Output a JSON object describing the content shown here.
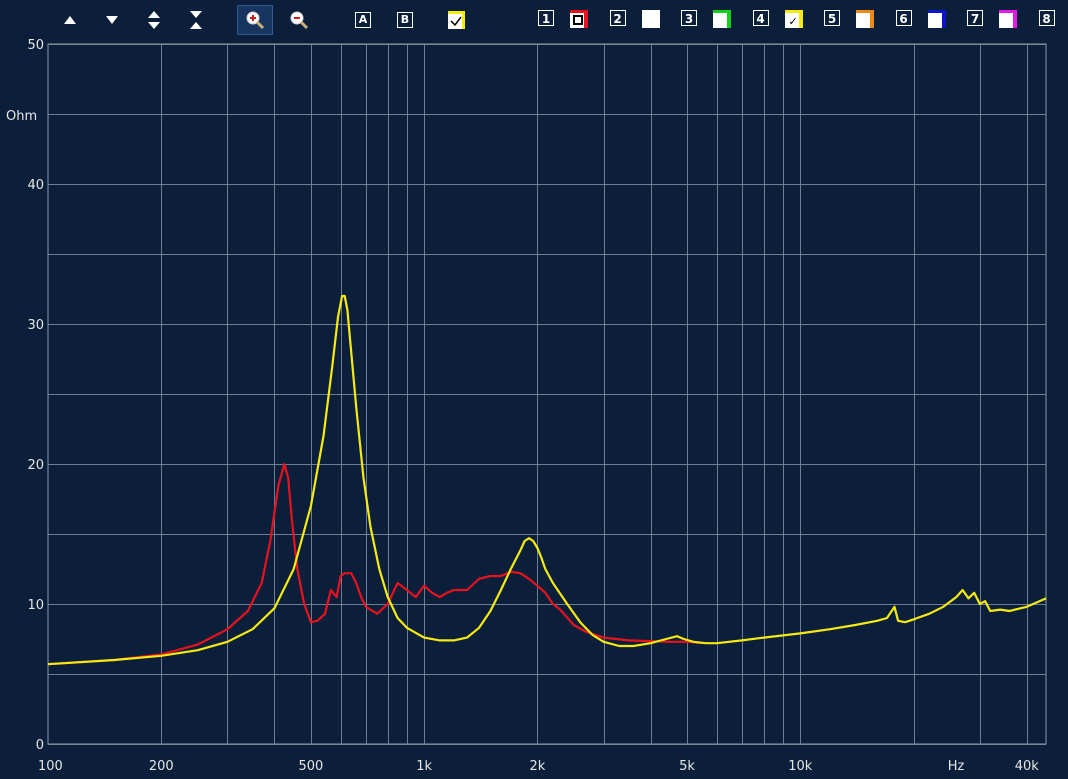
{
  "toolbar": {
    "tools": [
      {
        "name": "up-arrow-icon"
      },
      {
        "name": "down-arrow-icon"
      },
      {
        "name": "expand-vertical-icon"
      },
      {
        "name": "collapse-vertical-icon"
      },
      {
        "name": "zoom-in-icon"
      },
      {
        "name": "zoom-out-icon"
      }
    ],
    "cursor_a_label": "A",
    "cursor_b_label": "B",
    "channels": [
      {
        "label": "1",
        "color": "#e8121e",
        "checked": false,
        "square": true
      },
      {
        "label": "2",
        "color": "#ffffff",
        "checked": false
      },
      {
        "label": "3",
        "color": "#12d11b",
        "checked": false
      },
      {
        "label": "4",
        "color": "#f5ea12",
        "checked": true
      },
      {
        "label": "5",
        "color": "#f08a14",
        "checked": false
      },
      {
        "label": "6",
        "color": "#0a14c8",
        "checked": false
      },
      {
        "label": "7",
        "color": "#e619e6",
        "checked": false
      },
      {
        "label": "8",
        "color": "#ffffff",
        "checked": false
      }
    ]
  },
  "chart_data": {
    "type": "line",
    "ylabel": "Ohm",
    "xunit": "Hz",
    "xscale": "log",
    "xlim": [
      100,
      45000
    ],
    "ylim": [
      0,
      50
    ],
    "y_ticks": [
      0,
      10,
      20,
      30,
      40,
      50
    ],
    "x_tick_labels": [
      {
        "value": 100,
        "label": "100"
      },
      {
        "value": 200,
        "label": "200"
      },
      {
        "value": 500,
        "label": "500"
      },
      {
        "value": 1000,
        "label": "1k"
      },
      {
        "value": 2000,
        "label": "2k"
      },
      {
        "value": 5000,
        "label": "5k"
      },
      {
        "value": 10000,
        "label": "10k"
      },
      {
        "value": 40000,
        "label": "40k"
      }
    ],
    "grid": true,
    "series": [
      {
        "color": "#e8121e",
        "x": [
          100,
          150,
          200,
          250,
          300,
          340,
          370,
          390,
          410,
          425,
          435,
          445,
          460,
          480,
          500,
          520,
          545,
          565,
          585,
          600,
          615,
          640,
          660,
          680,
          700,
          750,
          800,
          850,
          900,
          950,
          1000,
          1050,
          1100,
          1150,
          1200,
          1300,
          1400,
          1500,
          1600,
          1700,
          1800,
          1900,
          2000,
          2100,
          2200,
          2300,
          2500,
          2700,
          3000,
          3500,
          4000,
          4500,
          5000,
          5500
        ],
        "y": [
          5.7,
          6.0,
          6.4,
          7.1,
          8.2,
          9.5,
          11.5,
          14.5,
          18.5,
          20.0,
          19.0,
          16.0,
          12.5,
          10.0,
          8.7,
          8.8,
          9.3,
          11.0,
          10.5,
          12.0,
          12.2,
          12.2,
          11.5,
          10.5,
          9.8,
          9.3,
          10.0,
          11.5,
          11.0,
          10.5,
          11.3,
          10.8,
          10.5,
          10.8,
          11.0,
          11.0,
          11.8,
          12.0,
          12.0,
          12.3,
          12.2,
          11.8,
          11.3,
          10.8,
          10.0,
          9.6,
          8.5,
          8.0,
          7.6,
          7.4,
          7.35,
          7.3,
          7.3,
          7.2
        ]
      },
      {
        "color": "#f5ea12",
        "x": [
          100,
          150,
          200,
          250,
          300,
          350,
          400,
          450,
          500,
          540,
          570,
          590,
          605,
          615,
          625,
          640,
          660,
          690,
          720,
          760,
          800,
          850,
          900,
          1000,
          1100,
          1200,
          1300,
          1400,
          1500,
          1600,
          1700,
          1800,
          1850,
          1900,
          1950,
          2000,
          2050,
          2100,
          2200,
          2400,
          2600,
          2800,
          3000,
          3300,
          3600,
          4000,
          4400,
          4700,
          4900,
          5200,
          5600,
          6000,
          7000,
          8000,
          10000,
          12000,
          14000,
          16000,
          17000,
          17800,
          18200,
          19000,
          20000,
          22000,
          24000,
          26000,
          27000,
          28000,
          29000,
          30000,
          31000,
          32000,
          34000,
          36000,
          40000,
          45000
        ],
        "y": [
          5.7,
          6.0,
          6.3,
          6.7,
          7.3,
          8.2,
          9.7,
          12.5,
          17.0,
          22.0,
          27.0,
          30.5,
          32.0,
          32.0,
          31.0,
          28.0,
          24.0,
          19.0,
          15.5,
          12.5,
          10.5,
          9.0,
          8.3,
          7.6,
          7.4,
          7.4,
          7.6,
          8.3,
          9.5,
          11.0,
          12.5,
          13.8,
          14.5,
          14.7,
          14.5,
          14.0,
          13.3,
          12.5,
          11.5,
          10.0,
          8.7,
          7.8,
          7.3,
          7.0,
          7.0,
          7.2,
          7.5,
          7.7,
          7.5,
          7.3,
          7.2,
          7.2,
          7.4,
          7.6,
          7.9,
          8.2,
          8.5,
          8.8,
          9.0,
          9.8,
          8.8,
          8.7,
          8.9,
          9.3,
          9.8,
          10.5,
          11.0,
          10.4,
          10.8,
          10.0,
          10.2,
          9.5,
          9.6,
          9.5,
          9.8,
          10.4
        ]
      }
    ]
  }
}
